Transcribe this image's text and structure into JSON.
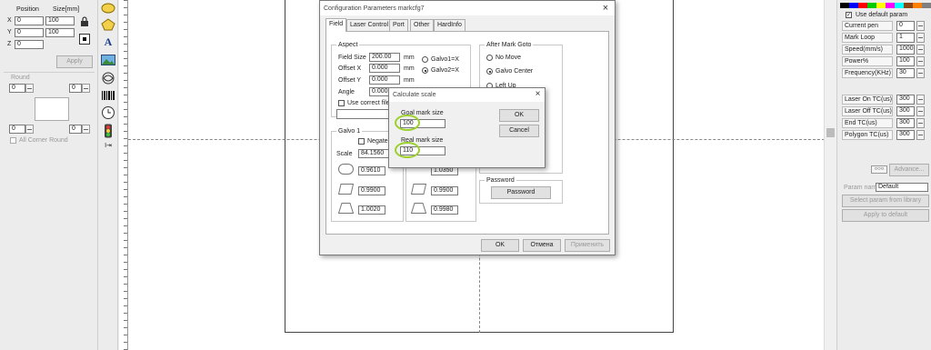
{
  "left_panel": {
    "position_header": "Position",
    "size_header": "Size[mm]",
    "x_label": "X",
    "y_label": "Y",
    "z_label": "Z",
    "x_pos": "0",
    "y_pos": "0",
    "z_pos": "0",
    "x_size": "100",
    "y_size": "100",
    "apply_label": "Apply",
    "round_label": "Round",
    "round_values": [
      "0",
      "0",
      "0",
      "0"
    ],
    "all_corner_round_label": "All Corner Round"
  },
  "toolbar": {
    "icons": [
      "ellipse-icon",
      "polygon-icon",
      "text-icon",
      "image-icon",
      "vector-icon",
      "barcode-icon",
      "clock-icon",
      "traffic-light-icon",
      "input-icon"
    ]
  },
  "main_dialog": {
    "title": "Configuration Parameters markcfg7",
    "tabs": [
      "Field",
      "Laser Control",
      "Port",
      "Other",
      "HardInfo"
    ],
    "active_tab": "Field",
    "aspect": {
      "title": "Aspect",
      "field_size_label": "Field Size",
      "field_size": "200.00",
      "field_size_unit": "mm",
      "offset_x_label": "Offset X",
      "offset_x": "0.000",
      "offset_x_unit": "mm",
      "offset_y_label": "Offset Y",
      "offset_y": "0.000",
      "offset_y_unit": "mm",
      "angle_label": "Angle",
      "angle": "0.000",
      "galvo1_label": "Galvo1=X",
      "galvo2_label": "Galvo2=X",
      "use_correct_file_label": "Use correct file"
    },
    "galvo1": {
      "title": "Galvo 1",
      "negate_label": "Negate",
      "scale_label": "Scale",
      "scale_value": "84.1560",
      "values": [
        "0.9610",
        "0.9900",
        "1.0020"
      ]
    },
    "galvo2": {
      "values": [
        "1.0350",
        "0.9900",
        "0.9980"
      ]
    },
    "after_mark_goto": {
      "title": "After Mark Goto",
      "options": [
        "No Move",
        "Galvo Center",
        "Left Up"
      ],
      "selected": "Galvo Center"
    },
    "password": {
      "title": "Password",
      "button_label": "Password"
    },
    "ok_label": "OK",
    "cancel_label": "Отмена",
    "apply_label": "Применить"
  },
  "scale_dialog": {
    "title": "Calculate scale",
    "goal_label": "Goal mark size",
    "goal_value": "100",
    "real_label": "Real mark size",
    "real_value": "110",
    "ok_label": "OK",
    "cancel_label": "Cancel"
  },
  "right_panel": {
    "palette": [
      "#000000",
      "#0000ff",
      "#ff0000",
      "#00cc00",
      "#ffff00",
      "#ff00ff",
      "#00ffff",
      "#8b4513",
      "#ff8000",
      "#808080"
    ],
    "use_default_label": "Use default param",
    "params": [
      {
        "label": "Current pen",
        "value": "0"
      },
      {
        "label": "Mark Loop",
        "value": "1"
      },
      {
        "label": "Speed(mm/s)",
        "value": "1000"
      },
      {
        "label": "Power%",
        "value": "100"
      },
      {
        "label": "Frequency(KHz)",
        "value": "30"
      },
      {
        "label": "Laser On TC(us)",
        "value": "300"
      },
      {
        "label": "Laser Off TC(us)",
        "value": "300"
      },
      {
        "label": "End TC(us)",
        "value": "300"
      },
      {
        "label": "Polygon TC(us)",
        "value": "300"
      }
    ],
    "advance_label": "Advance...",
    "param_name_label": "Param name",
    "param_name_value": "Default",
    "select_from_library_label": "Select param from library",
    "apply_to_default_label": "Apply to default"
  },
  "colors": {
    "highlight": "#9bd12a"
  }
}
